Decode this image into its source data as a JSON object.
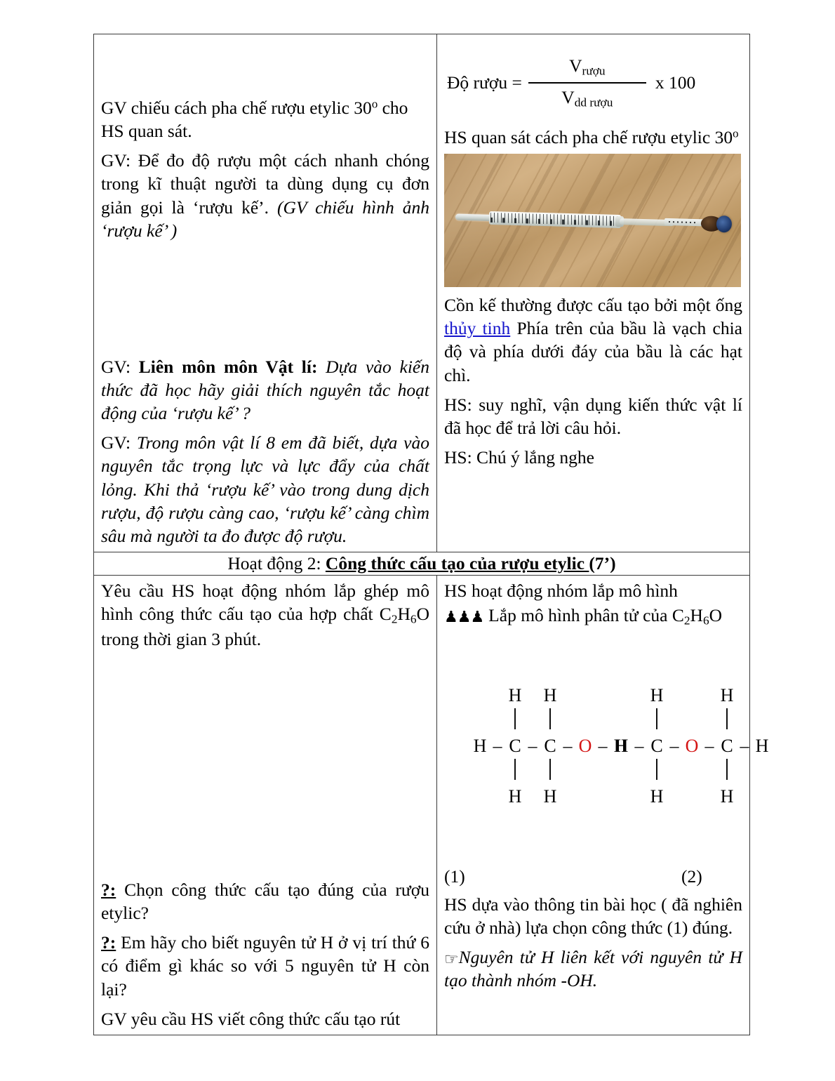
{
  "document": {
    "title": "Giáo án Hóa học 9 - Rượu etylic"
  },
  "table": {
    "row1": {
      "left": {
        "p1": "GV chiếu cách pha chế rượu etylic 30",
        "p1_sup": "o",
        "p1_tail": " cho HS quan sát.",
        "p2_a": "GV: Để đo độ rượu một cách nhanh chóng trong kĩ thuật  người ta dùng dụng cụ đơn giản gọi là ‘rượu kế’. ",
        "p2_b": "(GV chiếu hình ảnh ‘rượu kế’ )",
        "p3_lead": "GV: ",
        "p3_bold": "Liên môn môn Vật lí:",
        "p3_ital": " Dựa vào kiến thức đã học hãy giải thích nguyên tắc hoạt động của ‘rượu kế’ ?",
        "p4_lead": "GV: ",
        "p4_ital": "Trong môn vật lí 8 em đã biết, dựa vào nguyên tắc trọng lực và lực đẩy của chất lỏng.  Khi thả ‘rượu kế’ vào trong dung dịch rượu, độ rượu càng cao, ‘rượu kế’ càng chìm sâu mà người ta đo được độ rượu."
      },
      "right": {
        "formula_lhs": "Độ rượu =",
        "formula_numerator_main": "V",
        "formula_numerator_sub": "rượu",
        "formula_denominator_main": "V",
        "formula_denominator_sub": "dd rượu",
        "formula_rhs": "x 100",
        "p1": "HS quan sát cách pha chế rượu etylic 30",
        "p1_sup": "o",
        "photo_alt": "alcoholmeter-photo",
        "p2_a": "Cồn kế thường được cấu tạo bởi một ống ",
        "p2_link": "thủy tinh",
        "p2_b": " Phía trên của bầu là vạch chia độ và phía dưới đáy của bầu là các hạt chì.",
        "p3": "HS: suy nghĩ, vận dụng kiến thức vật lí đã học để trả lời câu hỏi.",
        "p4": "HS: Chú ý lắng nghe"
      }
    },
    "activity_header": {
      "prefix": "Hoạt động 2: ",
      "title": "Công thức cấu tạo của rượu etylic ",
      "suffix": "(7’)"
    },
    "row2": {
      "left": {
        "p1_a": "Yêu cầu HS hoạt động nhóm lắp ghép mô hình công thức cấu tạo của hợp chất C",
        "p1_sub1": "2",
        "p1_b": "H",
        "p1_sub2": "6",
        "p1_c": "O trong thời gian 3 phút.",
        "p2_q": "?:",
        "p2_text": " Chọn công thức cấu tạo đúng của rượu etylic?",
        "p3_q": "?:",
        "p3_text": " Em hãy cho biết nguyên tử H ở vị trí thứ 6 có điểm gì khác so với 5 nguyên tử H còn lại?",
        "p4": "GV yêu cầu HS viết công thức cấu tạo rút"
      },
      "right": {
        "p1": "HS hoạt động nhóm lắp mô hình",
        "people_icon": "people-group-icon",
        "p2_a": "Lắp mô hình phân tử  của C",
        "p2_sub1": "2",
        "p2_b": "H",
        "p2_sub2": "6",
        "p2_c": "O",
        "caption1": "(1)",
        "caption2": "(2)",
        "p3": "HS dựa vào thông tin bài học ( đã nghiên cứu ở nhà) lựa chọn công thức (1) đúng.",
        "hand_icon": "pointing-hand-icon",
        "p4_ital": "Nguyên tử H liên kết với nguyên tử H tạo thành nhóm -OH."
      }
    }
  },
  "molecules": {
    "oxygen_color": "#d41414",
    "structure1": {
      "name": "ethanol-structure",
      "top_atoms": [
        "H",
        "H"
      ],
      "backbone": [
        "H",
        "C",
        "C",
        "O",
        "H"
      ],
      "bottom_atoms": [
        "H",
        "H"
      ],
      "label": "(1)"
    },
    "structure2": {
      "name": "dimethyl-ether-structure",
      "top_atoms": [
        "H",
        "H"
      ],
      "backbone": [
        "H",
        "C",
        "O",
        "C",
        "H"
      ],
      "bottom_atoms": [
        "H",
        "H"
      ],
      "label": "(2)"
    }
  },
  "icons": {
    "people": "♟♟♟",
    "hand": "☞"
  }
}
